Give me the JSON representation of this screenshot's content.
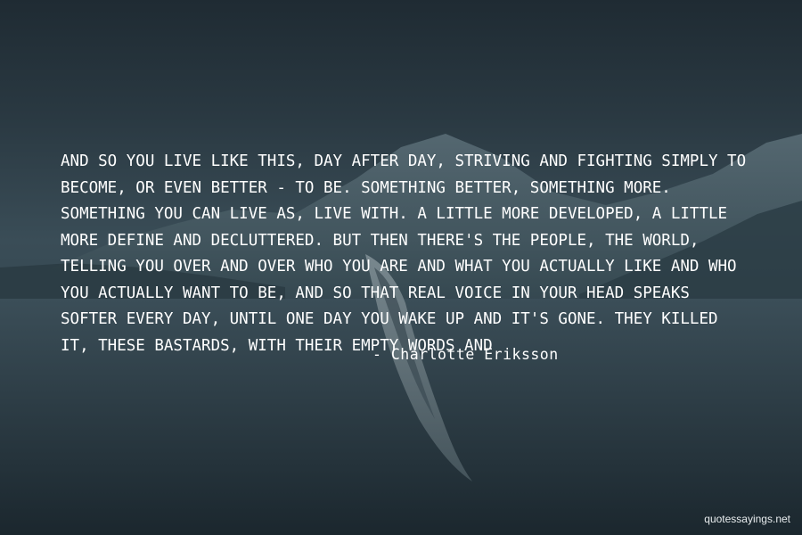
{
  "quote": {
    "text": "And so you live like this, day after day, striving and fighting simply to become, or even better - to be. Something better, something more. Something you can live as, live with. A little more developed, a little more define and decluttered. But then there's the people, the world, telling you over and over who you are and what you actually like and who you actually want to be, and so that real voice in your head speaks softer every day, until one day you wake up and it's gone. They killed it, these bastards, with their empty words and",
    "author": "- Charlotte Eriksson"
  },
  "watermark": "quotessayings.net",
  "colors": {
    "text": "#ffffff",
    "sky": "#2a3942",
    "water": "#24343d",
    "mountain": "#3f535d",
    "boat": "#7a8a90"
  }
}
